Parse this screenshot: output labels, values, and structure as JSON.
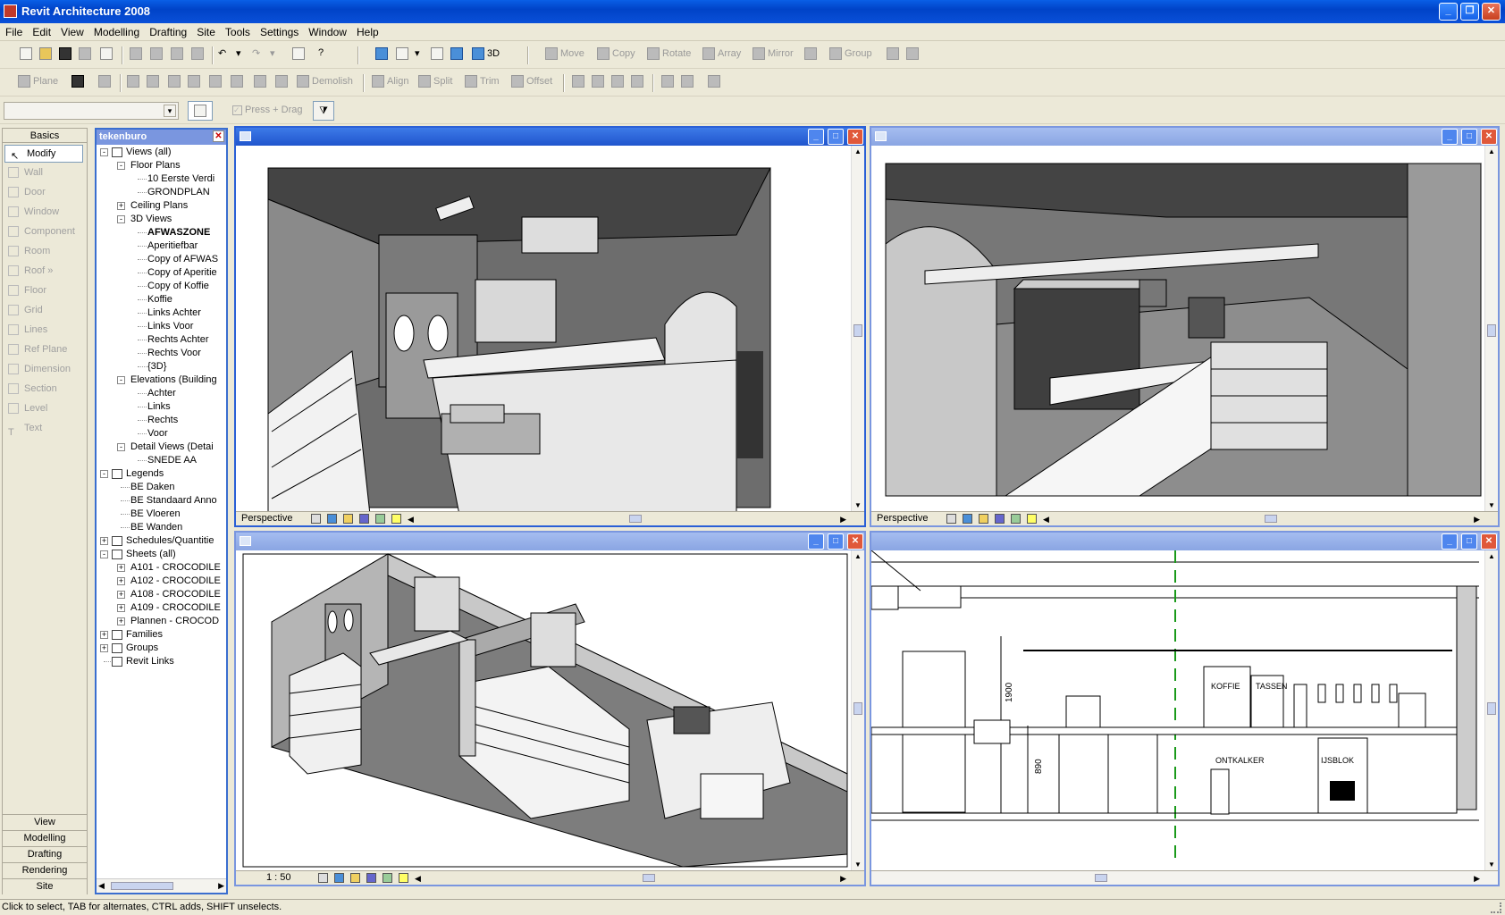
{
  "window": {
    "title": "Revit Architecture 2008"
  },
  "menu": [
    "File",
    "Edit",
    "View",
    "Modelling",
    "Drafting",
    "Site",
    "Tools",
    "Settings",
    "Window",
    "Help"
  ],
  "toolbar1": {
    "view3d_label": "3D",
    "move": "Move",
    "copy": "Copy",
    "rotate": "Rotate",
    "array": "Array",
    "mirror": "Mirror",
    "group": "Group"
  },
  "toolbar2": {
    "plane": "Plane",
    "demolish": "Demolish",
    "align": "Align",
    "split": "Split",
    "trim": "Trim",
    "offset": "Offset"
  },
  "toolbar3": {
    "press_drag": "Press + Drag"
  },
  "designbar": {
    "header": "Basics",
    "items": [
      "Modify",
      "Wall",
      "Door",
      "Window",
      "Component",
      "Room",
      "Roof »",
      "Floor",
      "Grid",
      "Lines",
      "Ref Plane",
      "Dimension",
      "Section",
      "Level",
      "Text"
    ],
    "tabs": [
      "View",
      "Modelling",
      "Drafting",
      "Rendering",
      "Site"
    ]
  },
  "browser": {
    "title": "tekenburo",
    "rows": [
      {
        "text": "Views (all)",
        "lvl": 0,
        "box": "-"
      },
      {
        "text": "Floor Plans",
        "lvl": 1,
        "box": "-"
      },
      {
        "text": "10 Eerste Verdi",
        "lvl": 2
      },
      {
        "text": "GRONDPLAN",
        "lvl": 2
      },
      {
        "text": "Ceiling Plans",
        "lvl": 1,
        "box": "+"
      },
      {
        "text": "3D Views",
        "lvl": 1,
        "box": "-"
      },
      {
        "text": "AFWASZONE",
        "lvl": 2,
        "bold": true
      },
      {
        "text": "Aperitiefbar",
        "lvl": 2
      },
      {
        "text": "Copy of AFWAS",
        "lvl": 2
      },
      {
        "text": "Copy of Aperitie",
        "lvl": 2
      },
      {
        "text": "Copy of Koffie",
        "lvl": 2
      },
      {
        "text": "Koffie",
        "lvl": 2
      },
      {
        "text": "Links Achter",
        "lvl": 2
      },
      {
        "text": "Links Voor",
        "lvl": 2
      },
      {
        "text": "Rechts Achter",
        "lvl": 2
      },
      {
        "text": "Rechts Voor",
        "lvl": 2
      },
      {
        "text": "{3D}",
        "lvl": 2
      },
      {
        "text": "Elevations (Building",
        "lvl": 1,
        "box": "-"
      },
      {
        "text": "Achter",
        "lvl": 2
      },
      {
        "text": "Links",
        "lvl": 2
      },
      {
        "text": "Rechts",
        "lvl": 2
      },
      {
        "text": "Voor",
        "lvl": 2
      },
      {
        "text": "Detail Views (Detai",
        "lvl": 1,
        "box": "-"
      },
      {
        "text": "SNEDE AA",
        "lvl": 2
      },
      {
        "text": "Legends",
        "lvl": 0,
        "box": "-"
      },
      {
        "text": "BE Daken",
        "lvl": 1
      },
      {
        "text": "BE Standaard Anno",
        "lvl": 1
      },
      {
        "text": "BE Vloeren",
        "lvl": 1
      },
      {
        "text": "BE Wanden",
        "lvl": 1
      },
      {
        "text": "Schedules/Quantitie",
        "lvl": 0,
        "box": "+"
      },
      {
        "text": "Sheets (all)",
        "lvl": 0,
        "box": "-"
      },
      {
        "text": "A101 - CROCODILE",
        "lvl": 1,
        "box": "+"
      },
      {
        "text": "A102 - CROCODILE",
        "lvl": 1,
        "box": "+"
      },
      {
        "text": "A108 - CROCODILE",
        "lvl": 1,
        "box": "+"
      },
      {
        "text": "A109 - CROCODILE",
        "lvl": 1,
        "box": "+"
      },
      {
        "text": "Plannen - CROCOD",
        "lvl": 1,
        "box": "+"
      },
      {
        "text": "Families",
        "lvl": 0,
        "box": "+"
      },
      {
        "text": "Groups",
        "lvl": 0,
        "box": "+"
      },
      {
        "text": "Revit Links",
        "lvl": 0
      }
    ]
  },
  "views": {
    "v1": {
      "footer": "Perspective"
    },
    "v2": {
      "footer": "Perspective"
    },
    "v3": {
      "footer": "1 : 50"
    },
    "v4": {
      "labels": {
        "koffie": "KOFFIE",
        "tassen": "TASSEN",
        "ontkalker": "ONTKALKER",
        "ijsblok": "IJSBLOK",
        "dim1": "1900",
        "dim2": "890"
      }
    }
  },
  "status": "Click to select, TAB for alternates, CTRL adds, SHIFT unselects."
}
